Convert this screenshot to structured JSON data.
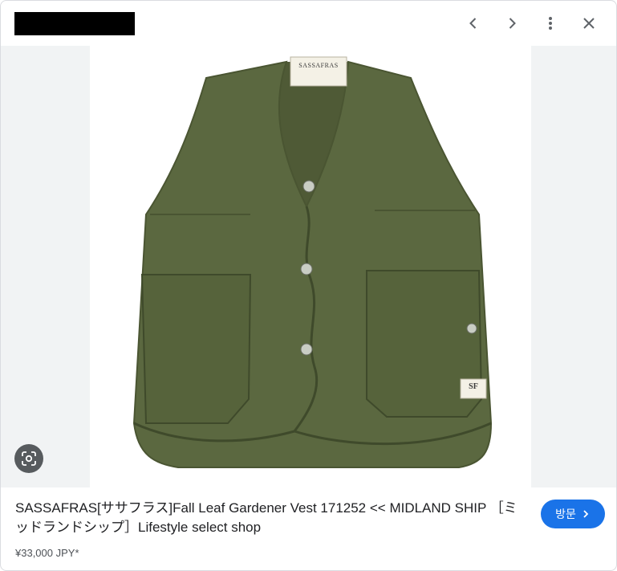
{
  "header": {
    "prev_icon": "chevron-left-icon",
    "next_icon": "chevron-right-icon",
    "more_icon": "more-vert-icon",
    "close_icon": "close-icon"
  },
  "image": {
    "subject_icon": "green-vest-illustration",
    "neck_label": "SASSAFRAS",
    "pocket_tag": "SF",
    "lens_icon": "lens-search-icon",
    "background_color": "#f1f3f4"
  },
  "details": {
    "title": "SASSAFRAS[ササフラス]Fall Leaf Gardener Vest 171252 << MIDLAND SHIP ［ミッドランドシップ］Lifestyle select shop",
    "price": "¥33,000 JPY*",
    "visit_label": "방문",
    "visit_color": "#1a73e8"
  }
}
